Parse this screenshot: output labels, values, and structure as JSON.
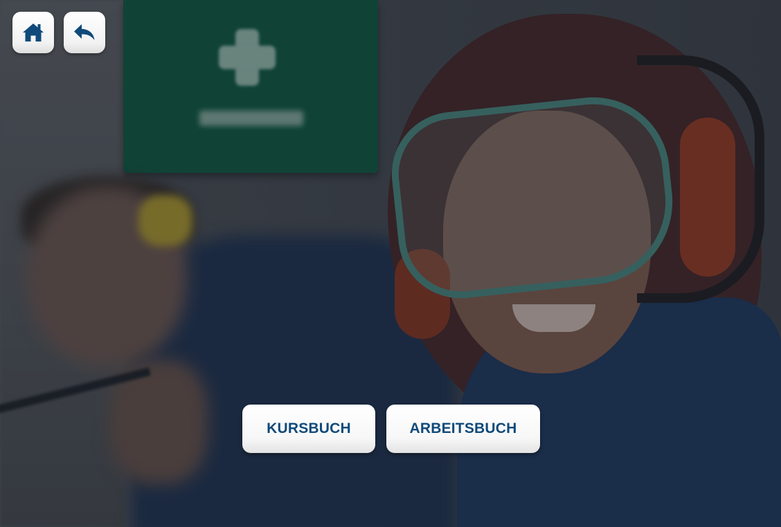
{
  "toolbar": {
    "home_icon": "home-icon",
    "back_icon": "back-arrow-icon",
    "icon_color": "#0f4a7a"
  },
  "main": {
    "buttons": [
      {
        "label": "KURSBUCH"
      },
      {
        "label": "ARBEITSBUCH"
      }
    ],
    "accent_color": "#0f4a7a"
  }
}
